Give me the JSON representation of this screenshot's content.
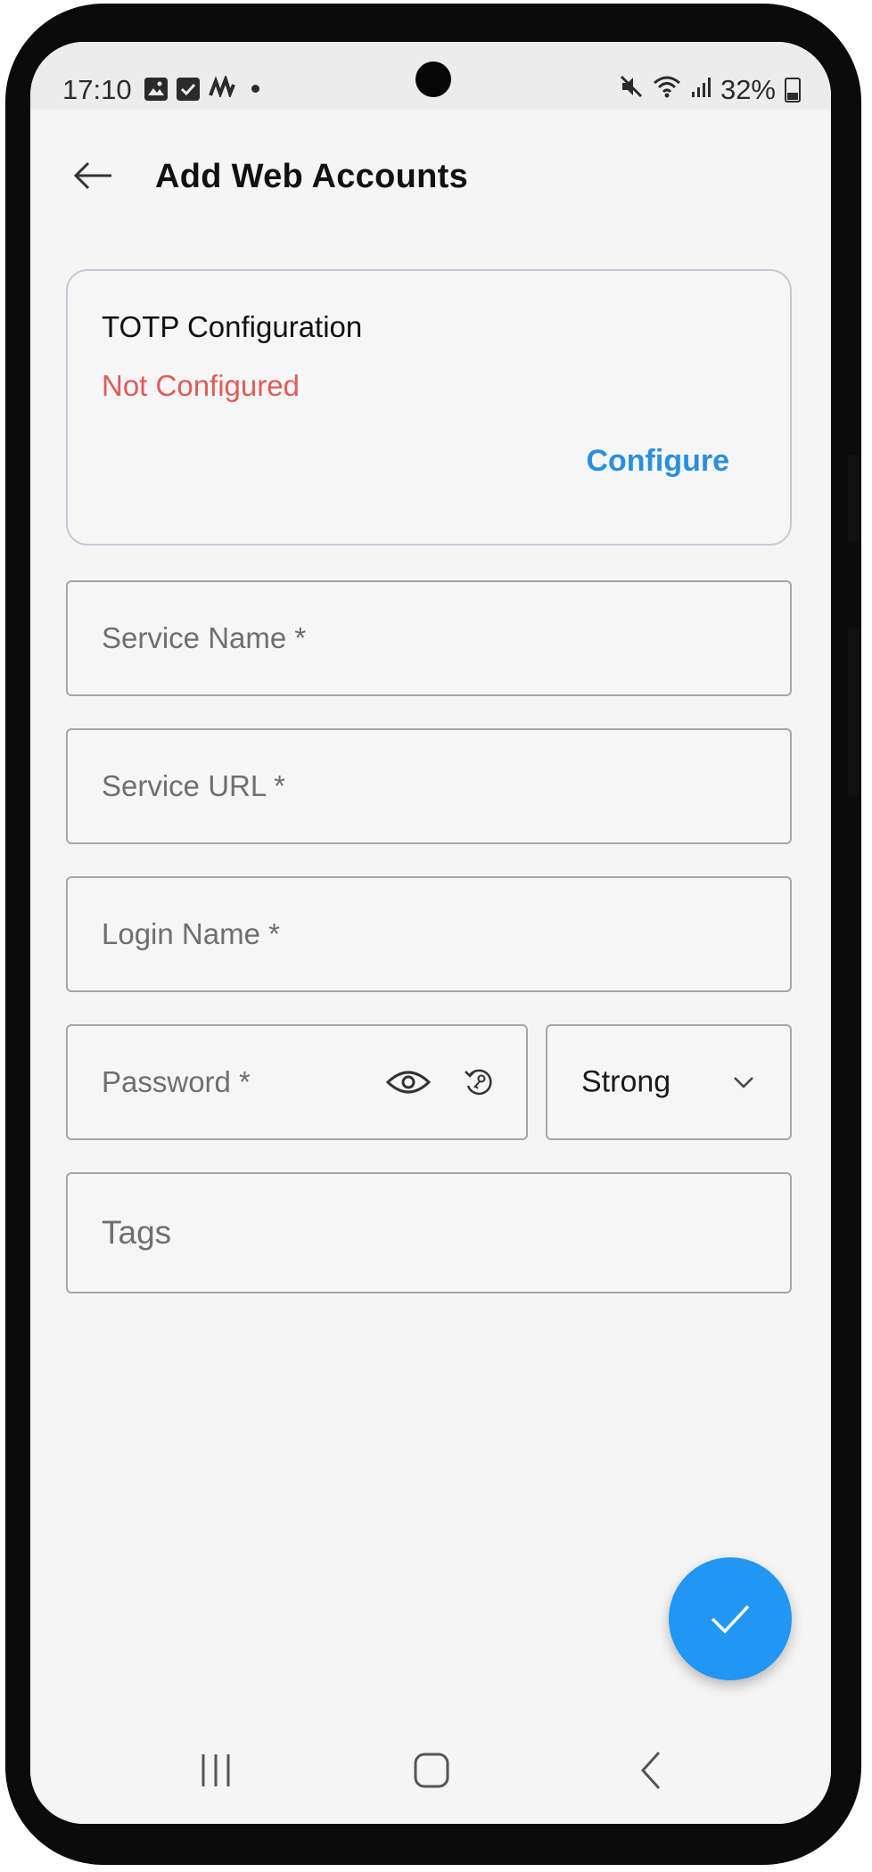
{
  "status_bar": {
    "time": "17:10",
    "notification_icons": [
      "image-icon",
      "checkbox-icon",
      "app-icon"
    ],
    "battery_percent": "32%",
    "right_icons": [
      "mute-icon",
      "wifi-icon",
      "signal-icon",
      "battery-icon"
    ]
  },
  "app_bar": {
    "back_icon": "arrow-left-icon",
    "title": "Add Web Accounts"
  },
  "totp": {
    "title": "TOTP Configuration",
    "status": "Not Configured",
    "action_label": "Configure",
    "status_color": "#e35b57",
    "action_color": "#2a8fe0"
  },
  "form": {
    "service_name": {
      "placeholder": "Service Name *",
      "value": ""
    },
    "service_url": {
      "placeholder": "Service URL *",
      "value": ""
    },
    "login_name": {
      "placeholder": "Login Name *",
      "value": ""
    },
    "password": {
      "placeholder": "Password *",
      "value": "",
      "visibility_icon": "eye-icon",
      "generate_icon": "password-generate-icon"
    },
    "strength": {
      "selected": "Strong",
      "icon": "chevron-down-icon"
    },
    "tags": {
      "placeholder": "Tags",
      "value": ""
    }
  },
  "fab": {
    "icon": "check-icon",
    "color": "#2196f3"
  },
  "nav_bar": {
    "items": [
      "recent-apps-icon",
      "home-icon",
      "back-icon"
    ]
  }
}
